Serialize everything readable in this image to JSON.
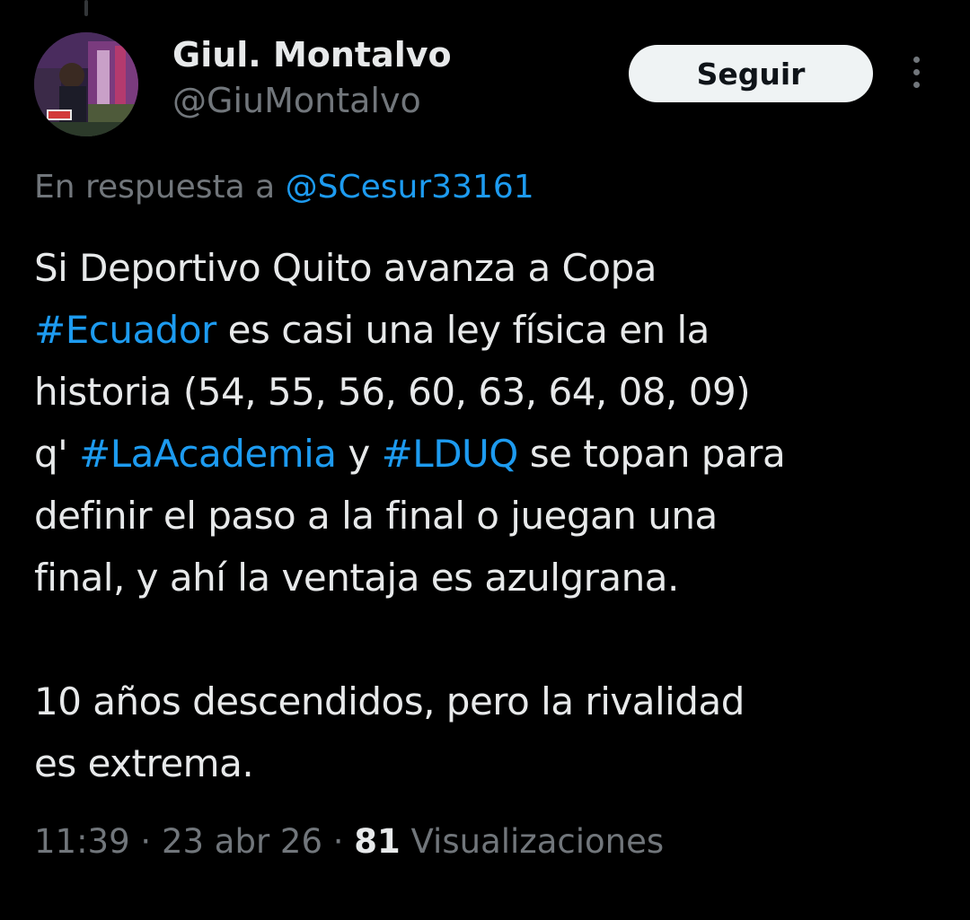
{
  "author": {
    "display_name": "Giul. Montalvo",
    "handle": "@GiuMontalvo"
  },
  "follow_button": {
    "label": "Seguir"
  },
  "more_options": {
    "icon": "more-vertical-icon"
  },
  "reply_context": {
    "prefix": "En respuesta a",
    "mention": "@SCesur33161"
  },
  "tweet": {
    "line1": "Si Deportivo Quito avanza a Copa",
    "hashtag_ecuador": "#Ecuador",
    "line2_rest": " es casi una ley física en la",
    "line3": "historia (54, 55, 56, 60, 63, 64, 08, 09)",
    "line4_prefix": "q' ",
    "hashtag_laacademia": "#LaAcademia",
    "line4_mid": " y ",
    "hashtag_lduq": "#LDUQ",
    "line4_rest": " se topan para",
    "line5": "definir el paso a la final o juegan una",
    "line6": "final, y ahí la ventaja es azulgrana.",
    "line7": "10 años descendidos, pero la rivalidad",
    "line8": "es extrema."
  },
  "meta": {
    "time": "11:39",
    "separator": " · ",
    "date": "23 abr 26",
    "views_count": "81",
    "views_label": " Visualizaciones"
  },
  "colors": {
    "background": "#000000",
    "text": "#e7e9ea",
    "secondary": "#71767b",
    "link": "#1d9bf0",
    "button_bg": "#eff3f4"
  }
}
